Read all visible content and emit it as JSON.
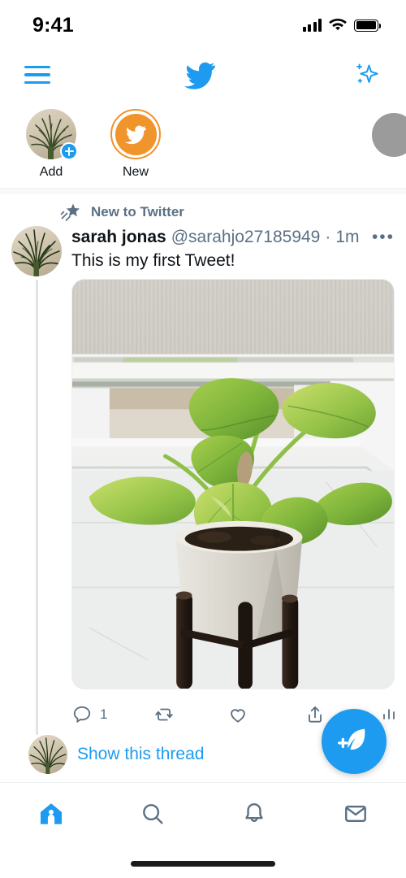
{
  "status_bar": {
    "time": "9:41",
    "signal_icon": "signal-bars-icon",
    "wifi_icon": "wifi-icon",
    "battery_icon": "battery-full-icon"
  },
  "top_nav": {
    "menu_icon": "hamburger-menu-icon",
    "logo_icon": "twitter-bird-logo",
    "sparkle_icon": "sparkles-icon",
    "accent_color": "#1d9bf0"
  },
  "fleets": {
    "items": [
      {
        "label": "Add",
        "type": "add-fleet",
        "badge_icon": "plus-badge-icon",
        "avatar_icon": "plant-avatar"
      },
      {
        "label": "New",
        "type": "new-fleet",
        "ring_color": "#f0922b",
        "fill_color": "#f0942c",
        "icon": "twitter-bird-logo"
      }
    ],
    "placeholder_color": "#9b9b9b"
  },
  "tweet": {
    "social_context": {
      "icon": "shooting-star-icon",
      "text": "New to Twitter"
    },
    "display_name": "sarah jonas",
    "handle": "@sarahjo27185949",
    "timestamp": "1m",
    "separator": "·",
    "more_icon": "more-options-icon",
    "text": "This is my first Tweet!",
    "media": {
      "alt": "Pothos houseplant in a white ceramic pot on a dark wooden tripod stand, on a white windowsill with a pleated blind above"
    },
    "actions": [
      {
        "name": "reply",
        "icon": "reply-icon",
        "count": "1"
      },
      {
        "name": "retweet",
        "icon": "retweet-icon",
        "count": ""
      },
      {
        "name": "like",
        "icon": "heart-icon",
        "count": ""
      },
      {
        "name": "share",
        "icon": "share-icon",
        "count": ""
      },
      {
        "name": "analytics",
        "icon": "analytics-bars-icon",
        "count": ""
      }
    ],
    "show_thread_label": "Show this thread",
    "link_color": "#1d9bf0"
  },
  "compose_fab": {
    "icon": "compose-feather-icon",
    "background": "#1d9bf0"
  },
  "bottom_nav": {
    "items": [
      {
        "name": "home",
        "icon": "home-icon",
        "active": true
      },
      {
        "name": "search",
        "icon": "search-icon",
        "active": false
      },
      {
        "name": "notifications",
        "icon": "bell-icon",
        "active": false
      },
      {
        "name": "messages",
        "icon": "envelope-icon",
        "active": false
      }
    ],
    "active_color": "#1d9bf0",
    "inactive_color": "#5b7083"
  }
}
